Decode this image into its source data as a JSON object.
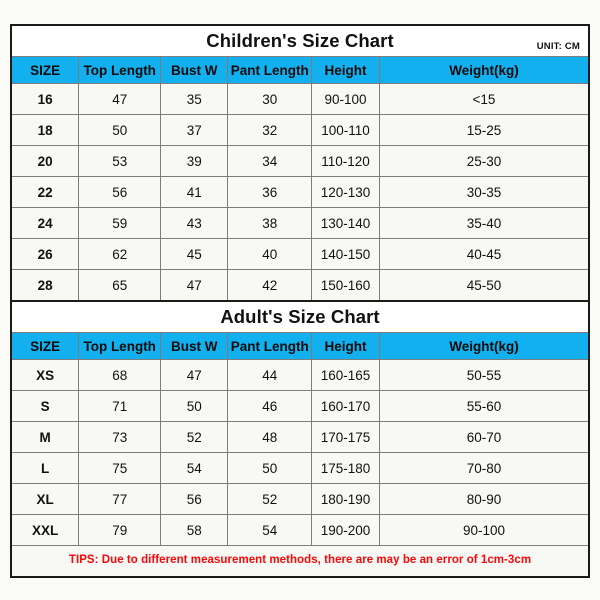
{
  "frame": {
    "accent_blue": "#12b0ee",
    "border_color": "#1a1a1a",
    "cell_bg": "#f8f8f5",
    "tips_color": "#fb0808"
  },
  "children": {
    "title": "Children's Size Chart",
    "unit_label": "UNIT: CM",
    "columns": [
      "SIZE",
      "Top Length",
      "Bust W",
      "Pant Length",
      "Height",
      "Weight(kg)"
    ],
    "rows": [
      [
        "16",
        "47",
        "35",
        "30",
        "90-100",
        "<15"
      ],
      [
        "18",
        "50",
        "37",
        "32",
        "100-110",
        "15-25"
      ],
      [
        "20",
        "53",
        "39",
        "34",
        "110-120",
        "25-30"
      ],
      [
        "22",
        "56",
        "41",
        "36",
        "120-130",
        "30-35"
      ],
      [
        "24",
        "59",
        "43",
        "38",
        "130-140",
        "35-40"
      ],
      [
        "26",
        "62",
        "45",
        "40",
        "140-150",
        "40-45"
      ],
      [
        "28",
        "65",
        "47",
        "42",
        "150-160",
        "45-50"
      ]
    ]
  },
  "adult": {
    "title": "Adult's Size Chart",
    "columns": [
      "SIZE",
      "Top Length",
      "Bust W",
      "Pant Length",
      "Height",
      "Weight(kg)"
    ],
    "rows": [
      [
        "XS",
        "68",
        "47",
        "44",
        "160-165",
        "50-55"
      ],
      [
        "S",
        "71",
        "50",
        "46",
        "160-170",
        "55-60"
      ],
      [
        "M",
        "73",
        "52",
        "48",
        "170-175",
        "60-70"
      ],
      [
        "L",
        "75",
        "54",
        "50",
        "175-180",
        "70-80"
      ],
      [
        "XL",
        "77",
        "56",
        "52",
        "180-190",
        "80-90"
      ],
      [
        "XXL",
        "79",
        "58",
        "54",
        "190-200",
        "90-100"
      ]
    ]
  },
  "tips": "TIPS: Due to different measurement methods, there are may be an error of 1cm-3cm"
}
